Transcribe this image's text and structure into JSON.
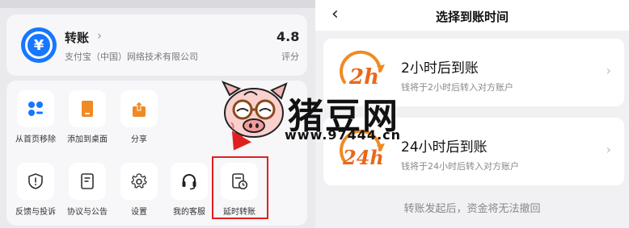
{
  "left": {
    "app": {
      "name": "转账",
      "company": "支付宝（中国）网络技术有限公司",
      "rating": "4.8",
      "rating_label": "评分",
      "icon": "yuan-transfer-icon"
    },
    "actions": [
      {
        "label": "从首页移除",
        "icon": "remove-grid-icon"
      },
      {
        "label": "添加到桌面",
        "icon": "add-to-desktop-icon"
      },
      {
        "label": "分享",
        "icon": "share-icon"
      },
      {
        "label": "反馈与投诉",
        "icon": "shield-alert-icon"
      },
      {
        "label": "协议与公告",
        "icon": "document-icon"
      },
      {
        "label": "设置",
        "icon": "gear-icon"
      },
      {
        "label": "我的客服",
        "icon": "headset-icon"
      },
      {
        "label": "延时转账",
        "icon": "delayed-transfer-icon"
      }
    ],
    "highlight_color": "#e02020"
  },
  "right": {
    "nav": {
      "back_icon": "chevron-left-icon",
      "title": "选择到账时间"
    },
    "options": [
      {
        "logo_text": "2h",
        "title": "2小时后到账",
        "subtitle": "钱将于2小时后转入对方账户"
      },
      {
        "logo_text": "24h",
        "title": "24小时后到账",
        "subtitle": "钱将于24小时后转入对方账户"
      }
    ],
    "notice": "转账发起后，资金将无法撤回"
  },
  "watermark": {
    "title": "猪豆网",
    "url": "www.97444.cn"
  },
  "colors": {
    "accent_blue": "#1677ff",
    "orange": "#f08a24",
    "red": "#e02020"
  }
}
